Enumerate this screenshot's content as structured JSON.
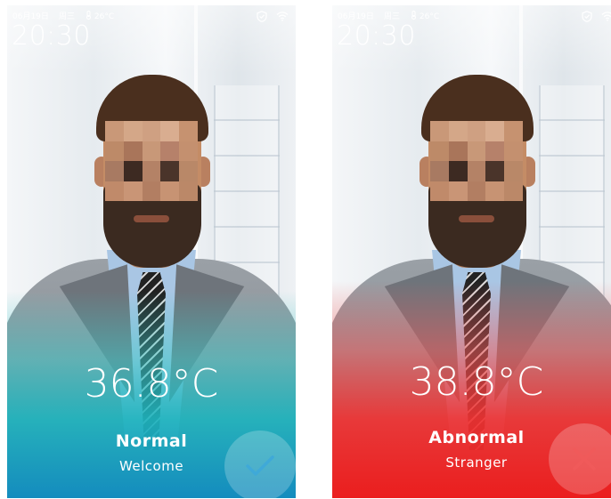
{
  "colors": {
    "normal_accent": "#1fb8c4",
    "normal_bottom": "#148cbe",
    "abnormal_accent": "#f03232",
    "check_mark": "#3fa9d8",
    "cross_mark": "#f05a5a"
  },
  "screens": [
    {
      "id": "normal",
      "statusbar": {
        "date": "06月19日",
        "weekday": "周三",
        "temperature_icon": "thermometer-icon",
        "weather_temp": "26°C",
        "shield_icon": "shield-check-icon",
        "wifi_icon": "wifi-icon"
      },
      "clock": "20:30",
      "body_temperature": "36.8°C",
      "status": "Normal",
      "message": "Welcome",
      "result_icon": "check-icon"
    },
    {
      "id": "abnormal",
      "statusbar": {
        "date": "06月19日",
        "weekday": "周三",
        "temperature_icon": "thermometer-icon",
        "weather_temp": "26°C",
        "shield_icon": "shield-check-icon",
        "wifi_icon": "wifi-icon"
      },
      "clock": "20:30",
      "body_temperature": "38.8°C",
      "status": "Abnormal",
      "message": "Stranger",
      "result_icon": "close-icon"
    }
  ]
}
